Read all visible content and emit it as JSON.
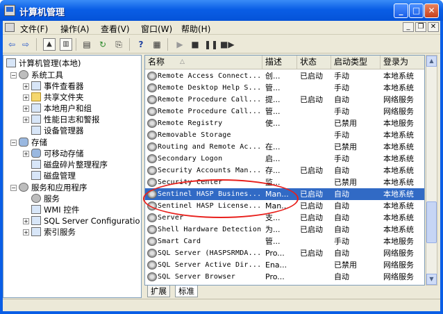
{
  "window": {
    "title": "计算机管理",
    "minimize_glyph": "_",
    "maximize_glyph": "□",
    "close_glyph": "✕"
  },
  "menubar": {
    "items": [
      "文件(F)",
      "操作(A)",
      "查看(V)",
      "窗口(W)",
      "帮助(H)"
    ]
  },
  "toolbar": {
    "icons": [
      "back-arrow-icon",
      "forward-arrow-icon",
      "up-folder-icon",
      "show-hide-tree-icon",
      "properties-icon",
      "refresh-icon",
      "export-list-icon",
      "help-icon",
      "console-tree-icon",
      "start-service-icon",
      "stop-service-icon",
      "pause-service-icon",
      "restart-service-icon"
    ]
  },
  "tree": {
    "root": "计算机管理(本地)",
    "system_tools": "系统工具",
    "event_viewer": "事件查看器",
    "shared_folders": "共享文件夹",
    "local_users": "本地用户和组",
    "perf_logs": "性能日志和警报",
    "device_manager": "设备管理器",
    "storage": "存储",
    "removable_storage": "可移动存储",
    "defrag": "磁盘碎片整理程序",
    "disk_mgmt": "磁盘管理",
    "services_apps": "服务和应用程序",
    "services": "服务",
    "wmi": "WMI 控件",
    "sql_config": "SQL Server Configuratio",
    "indexing": "索引服务"
  },
  "list": {
    "headers": {
      "name": "名称",
      "sort_glyph": "△",
      "desc": "描述",
      "status": "状态",
      "startup": "启动类型",
      "logon": "登录为"
    },
    "rows": [
      {
        "name": "Remote Access Connect...",
        "desc": "创...",
        "status": "已启动",
        "startup": "手动",
        "logon": "本地系统"
      },
      {
        "name": "Remote Desktop Help S...",
        "desc": "管...",
        "status": "",
        "startup": "手动",
        "logon": "本地系统"
      },
      {
        "name": "Remote Procedure Call...",
        "desc": "提...",
        "status": "已启动",
        "startup": "自动",
        "logon": "网络服务"
      },
      {
        "name": "Remote Procedure Call...",
        "desc": "管...",
        "status": "",
        "startup": "手动",
        "logon": "网络服务"
      },
      {
        "name": "Remote Registry",
        "desc": "使...",
        "status": "",
        "startup": "已禁用",
        "logon": "本地服务"
      },
      {
        "name": "Removable Storage",
        "desc": "",
        "status": "",
        "startup": "手动",
        "logon": "本地系统"
      },
      {
        "name": "Routing and Remote Ac...",
        "desc": "在...",
        "status": "",
        "startup": "已禁用",
        "logon": "本地系统"
      },
      {
        "name": "Secondary Logon",
        "desc": "启...",
        "status": "",
        "startup": "手动",
        "logon": "本地系统"
      },
      {
        "name": "Security Accounts Man...",
        "desc": "存...",
        "status": "已启动",
        "startup": "自动",
        "logon": "本地系统"
      },
      {
        "name": "Security Center",
        "desc": "监...",
        "status": "",
        "startup": "已禁用",
        "logon": "本地系统"
      },
      {
        "name": "Sentinel HASP Busines...",
        "desc": "Man...",
        "status": "已启动",
        "startup": "自动",
        "logon": "本地系统"
      },
      {
        "name": "Sentinel HASP License...",
        "desc": "Man...",
        "status": "已启动",
        "startup": "自动",
        "logon": "本地系统"
      },
      {
        "name": "Server",
        "desc": "支...",
        "status": "已启动",
        "startup": "自动",
        "logon": "本地系统"
      },
      {
        "name": "Shell Hardware Detection",
        "desc": "为...",
        "status": "已启动",
        "startup": "自动",
        "logon": "本地系统"
      },
      {
        "name": "Smart Card",
        "desc": "管...",
        "status": "",
        "startup": "手动",
        "logon": "本地服务"
      },
      {
        "name": "SQL Server (HASPSRMDA...",
        "desc": "Pro...",
        "status": "已启动",
        "startup": "自动",
        "logon": "网络服务"
      },
      {
        "name": "SQL Server Active Dir...",
        "desc": "Ena...",
        "status": "",
        "startup": "已禁用",
        "logon": "网络服务"
      },
      {
        "name": "SQL Server Browser",
        "desc": "Pro...",
        "status": "",
        "startup": "自动",
        "logon": "网络服务"
      }
    ],
    "selected_index": 10
  },
  "tabs": {
    "extended": "扩展",
    "standard": "标准"
  },
  "colors": {
    "selection": "#316ac5",
    "annotation": "#e8201c"
  }
}
